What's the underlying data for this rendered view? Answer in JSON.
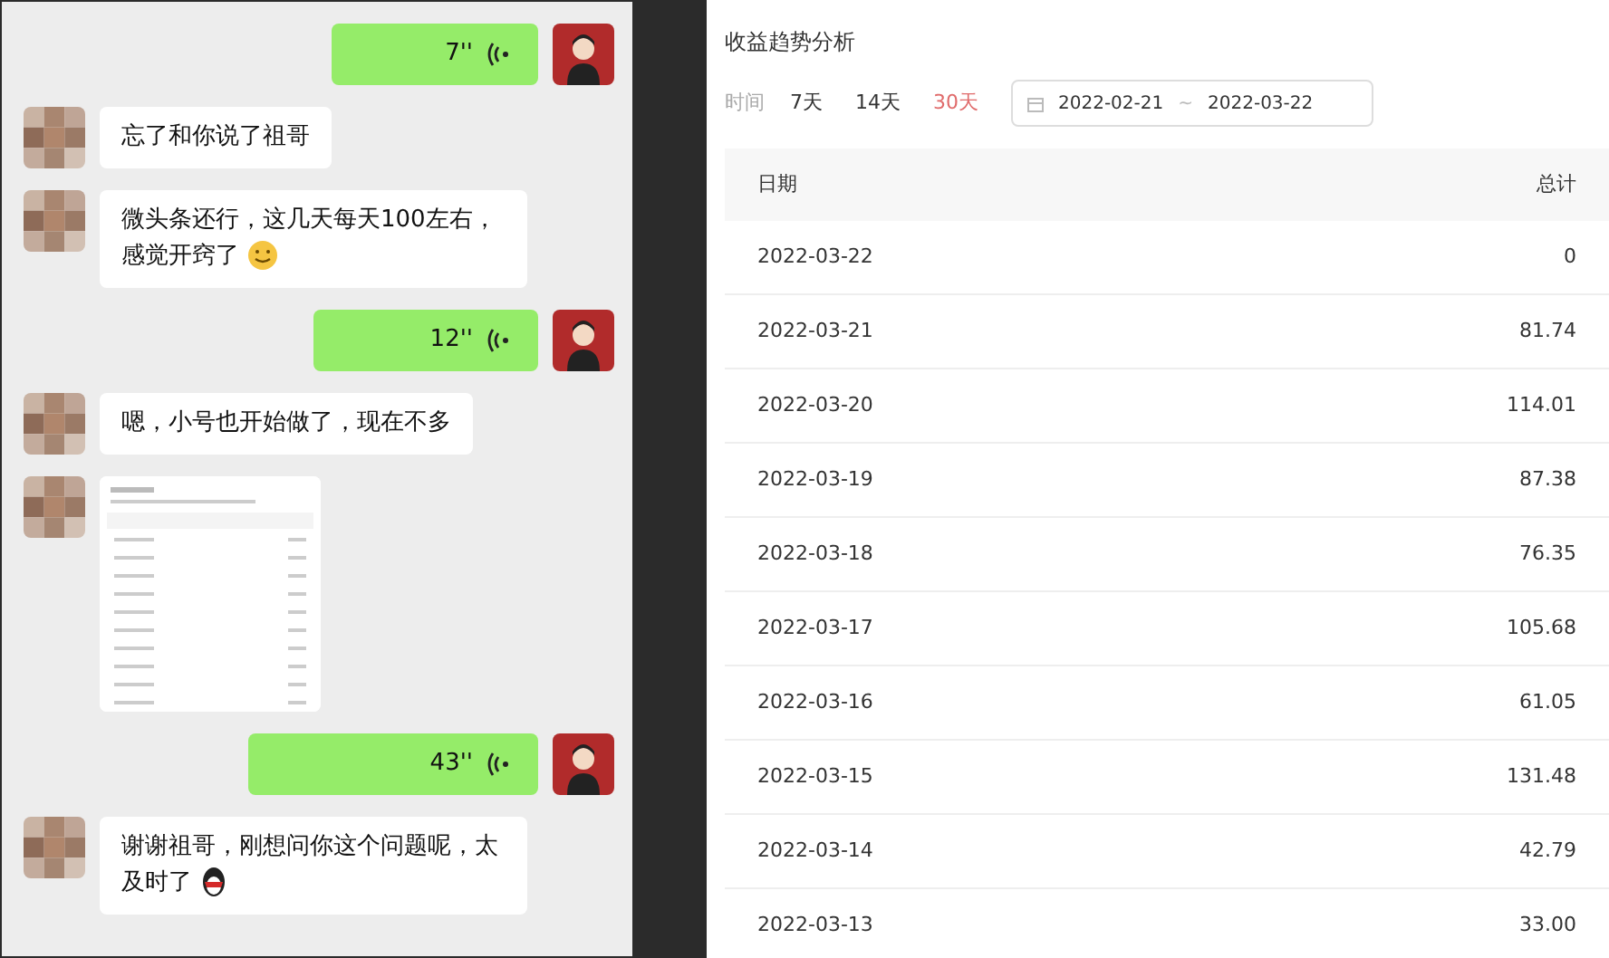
{
  "chat": {
    "messages": [
      {
        "kind": "voice",
        "duration": "7''"
      },
      {
        "kind": "text",
        "text": "忘了和你说了祖哥"
      },
      {
        "kind": "text",
        "text": "微头条还行，这几天每天100左右，感觉开窍了",
        "emoji": {
          "kind": "smiley"
        }
      },
      {
        "kind": "voice",
        "duration": "12''"
      },
      {
        "kind": "text",
        "text": "嗯，小号也开始做了，现在不多"
      },
      {
        "kind": "image"
      },
      {
        "kind": "voice",
        "duration": "43''"
      },
      {
        "kind": "text",
        "text": "谢谢祖哥，刚想问你这个问题呢，太及时了",
        "emoji": {
          "kind": "penguin"
        }
      }
    ]
  },
  "report": {
    "title": "收益趋势分析",
    "filter_label": "时间",
    "ranges": [
      {
        "label": "7天",
        "selected": false
      },
      {
        "label": "14天",
        "selected": false
      },
      {
        "label": "30天",
        "selected": true
      }
    ],
    "date_range": {
      "start": "2022-02-21",
      "separator": "~",
      "end": "2022-03-22"
    },
    "table": {
      "columns": [
        "日期",
        "总计"
      ],
      "rows": [
        [
          "2022-03-22",
          "0"
        ],
        [
          "2022-03-21",
          "81.74"
        ],
        [
          "2022-03-20",
          "114.01"
        ],
        [
          "2022-03-19",
          "87.38"
        ],
        [
          "2022-03-18",
          "76.35"
        ],
        [
          "2022-03-17",
          "105.68"
        ],
        [
          "2022-03-16",
          "61.05"
        ],
        [
          "2022-03-15",
          "131.48"
        ],
        [
          "2022-03-14",
          "42.79"
        ],
        [
          "2022-03-13",
          "33.00"
        ]
      ]
    }
  }
}
